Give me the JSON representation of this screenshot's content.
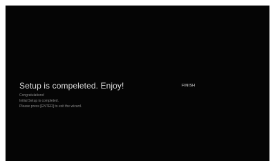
{
  "wizard": {
    "title": "Setup is compeleted. Enjoy!",
    "lines": [
      "Congratulations!",
      "Initial Setup is completed.",
      "Please press [ENTER] to exit the wizard."
    ],
    "finish_label": "FINISH"
  },
  "colors": {
    "background": "#050505",
    "title": "#dcdcdc",
    "body_text": "#8a8a8a",
    "button_text": "#e6e6e6"
  }
}
